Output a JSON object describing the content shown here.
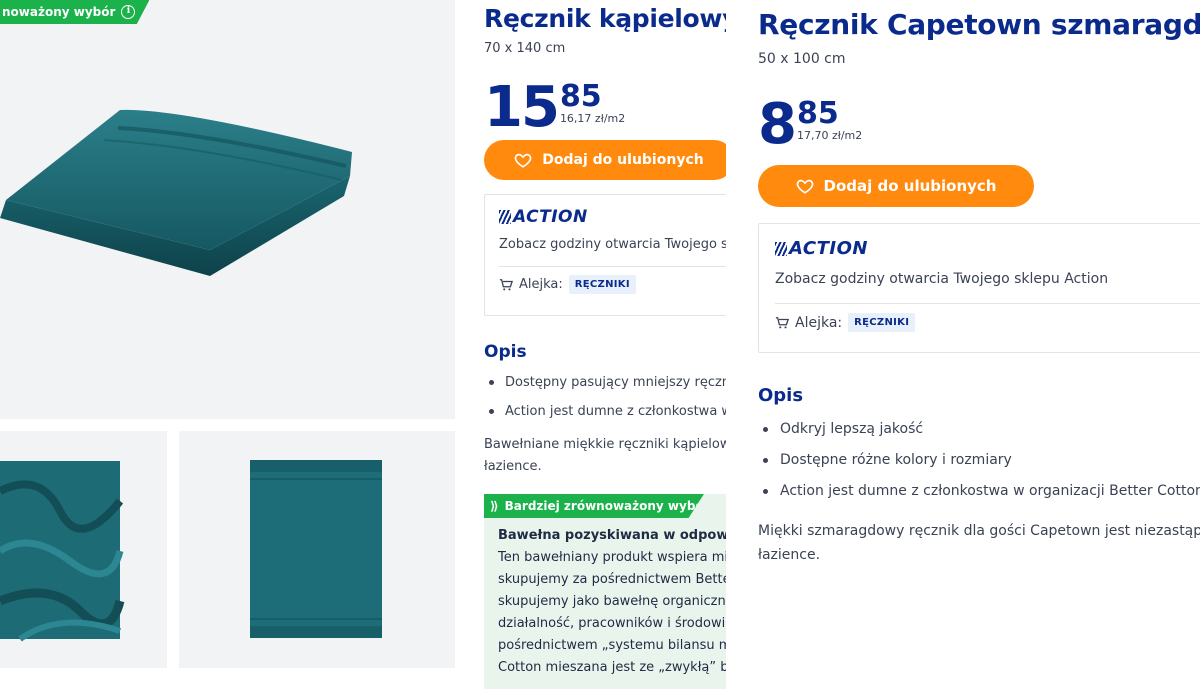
{
  "gallery": {
    "badge_text": "noważony wybór",
    "badge_info": "i"
  },
  "panel_a": {
    "title": "Ręcznik kąpielowy",
    "size": "70 x 140 cm",
    "price_int": "15",
    "price_dec": "85",
    "price_unit": "16,17 zł/m2",
    "fav_label": "Dodaj do ulubionych",
    "logo_text": "ACTION",
    "store_link": "Zobacz godziny otwarcia Twojego s",
    "aisle_label": "Alejka:",
    "aisle_tag": "RĘCZNIKI",
    "section_title": "Opis",
    "bullets": [
      "Dostępny pasujący mniejszy ręczn",
      "Action jest dumne z członkostwa w"
    ],
    "desc_lines": [
      "Bawełniane miękkie ręczniki kąpielow",
      "łazience."
    ],
    "sustainability": {
      "header": "Bardziej zrównoważony wybór",
      "header_icon": "⟫",
      "bold": "Bawełna pozyskiwana w odpowie",
      "lines": [
        "Ten bawełniany produkt wspiera mi",
        "skupujemy za pośrednictwem Bette",
        "skupujemy jako bawełnę organiczną",
        "działalność, pracowników i środowis",
        "pośrednictwem „systemu bilansu m",
        "Cotton mieszana jest ze „zwykłą” ba"
      ]
    }
  },
  "panel_b": {
    "title": "Ręcznik Capetown szmaragd",
    "size": "50 x 100 cm",
    "price_int": "8",
    "price_dec": "85",
    "price_unit": "17,70 zł/m2",
    "fav_label": "Dodaj do ulubionych",
    "logo_text": "ACTION",
    "store_link": "Zobacz godziny otwarcia Twojego sklepu Action",
    "aisle_label": "Alejka:",
    "aisle_tag": "RĘCZNIKI",
    "section_title": "Opis",
    "bullets": [
      "Odkryj lepszą jakość",
      "Dostępne różne kolory i rozmiary",
      "Action jest dumne z członkostwa w organizacji Better Cotton"
    ],
    "desc_lines": [
      "Miękki szmaragdowy ręcznik dla gości Capetown jest niezastąpi",
      "łazience."
    ]
  },
  "colors": {
    "brand_blue": "#0b2b8c",
    "accent_orange": "#ff8a0d",
    "green_badge": "#1bb24b",
    "towel_teal": "#1f6e78"
  }
}
